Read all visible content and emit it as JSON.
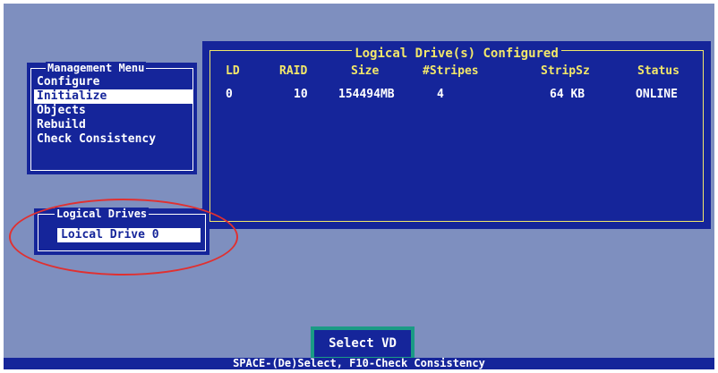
{
  "management_menu": {
    "title": "Management Menu",
    "items": [
      {
        "label": "Configure",
        "selected": false
      },
      {
        "label": "Initialize",
        "selected": true
      },
      {
        "label": "Objects",
        "selected": false
      },
      {
        "label": "Rebuild",
        "selected": false
      },
      {
        "label": "Check Consistency",
        "selected": false
      }
    ]
  },
  "configured_panel": {
    "title": "Logical Drive(s) Configured",
    "columns": [
      "LD",
      "RAID",
      "Size",
      "#Stripes",
      "StripSz",
      "Status"
    ],
    "rows": [
      [
        "0",
        "10",
        "154494MB",
        "4",
        "64 KB",
        "ONLINE"
      ]
    ]
  },
  "logical_drives": {
    "title": "Logical Drives",
    "selected_item": "Loical Drive 0"
  },
  "select_button": {
    "label": "Select VD"
  },
  "status_bar": {
    "text": "SPACE-(De)Select, F10-Check Consistency"
  },
  "colors": {
    "background": "#7e8fbf",
    "panel": "#15259a",
    "header_yellow": "#f2e76a",
    "button_border": "#1a9b85",
    "highlight_oval": "#e03030"
  }
}
